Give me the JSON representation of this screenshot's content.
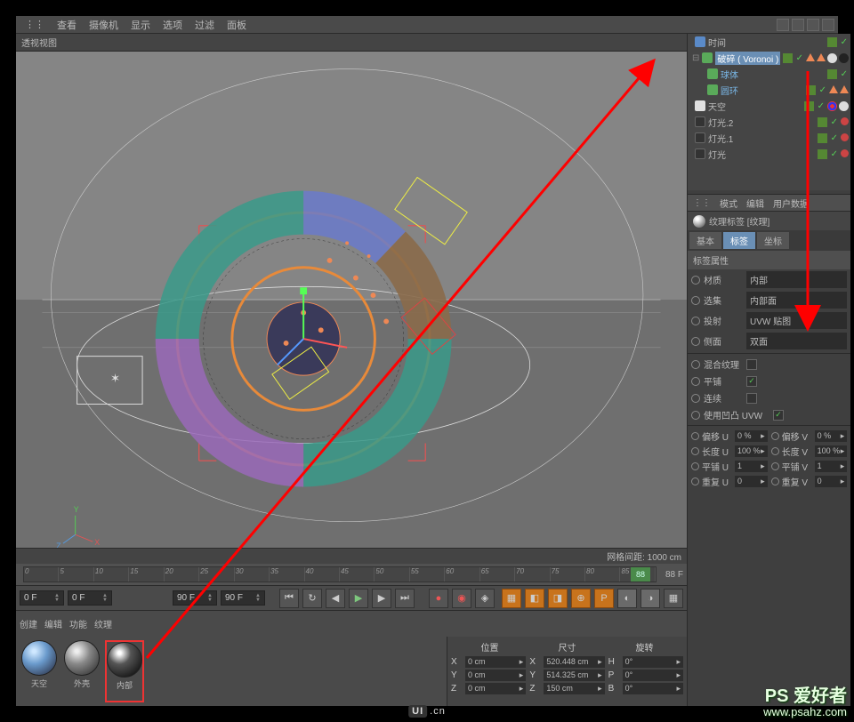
{
  "menu": {
    "view": "查看",
    "camera": "摄像机",
    "display": "显示",
    "options": "选项",
    "filter": "过滤",
    "panel": "面板"
  },
  "viewport": {
    "label": "透视视图",
    "footer": "网格间距: 1000 cm"
  },
  "timeline": {
    "ticks": [
      "0",
      "5",
      "10",
      "15",
      "20",
      "25",
      "30",
      "35",
      "40",
      "45",
      "50",
      "55",
      "60",
      "65",
      "70",
      "75",
      "80",
      "85"
    ],
    "playhead": "88",
    "frame_label": "88 F"
  },
  "transport": {
    "start": "0 F",
    "prev": "0 F",
    "end": "90 F",
    "next": "90 F"
  },
  "mat_menu": {
    "create": "创建",
    "edit": "编辑",
    "func": "功能",
    "tex": "纹理"
  },
  "materials": [
    {
      "id": "sky",
      "label": "天空"
    },
    {
      "id": "outer",
      "label": "外壳"
    },
    {
      "id": "inner",
      "label": "内部"
    }
  ],
  "coords": {
    "headers": [
      "位置",
      "尺寸",
      "旋转"
    ],
    "rows": [
      {
        "axis": "X",
        "pos": "0 cm",
        "size": "520.448 cm",
        "rot_lbl": "H",
        "rot": "0°"
      },
      {
        "axis": "Y",
        "pos": "0 cm",
        "size": "514.325 cm",
        "rot_lbl": "P",
        "rot": "0°"
      },
      {
        "axis": "Z",
        "pos": "0 cm",
        "size": "150 cm",
        "rot_lbl": "B",
        "rot": "0°"
      }
    ]
  },
  "objects": [
    {
      "name": "时间",
      "indent": 0,
      "icon": "blue",
      "tags": [
        "layer",
        "chk"
      ]
    },
    {
      "name": "破碎 ( Voronoi )",
      "indent": 0,
      "icon": "green",
      "sel": true,
      "expand": "⊟",
      "tags": [
        "layer",
        "chk",
        "tri",
        "tri",
        "sph",
        "sph-dk"
      ]
    },
    {
      "name": "球体",
      "indent": 1,
      "icon": "green",
      "blue": true,
      "tags": [
        "layer",
        "chk"
      ]
    },
    {
      "name": "圆环",
      "indent": 1,
      "icon": "green",
      "blue": true,
      "tags": [
        "layer",
        "chk",
        "tri",
        "tri"
      ]
    },
    {
      "name": "天空",
      "indent": 0,
      "icon": "white",
      "tags": [
        "layer",
        "chk",
        "tgt",
        "sph"
      ]
    },
    {
      "name": "灯光.2",
      "indent": 0,
      "icon": "black",
      "tags": [
        "layer",
        "chk",
        "small"
      ]
    },
    {
      "name": "灯光.1",
      "indent": 0,
      "icon": "black",
      "tags": [
        "layer",
        "chk",
        "small"
      ]
    },
    {
      "name": "灯光",
      "indent": 0,
      "icon": "black",
      "tags": [
        "layer",
        "chk",
        "small"
      ]
    }
  ],
  "attr_header": {
    "mode": "模式",
    "edit": "编辑",
    "user": "用户数据"
  },
  "attr_title": "纹理标签 [纹理]",
  "attr_tabs": {
    "basic": "基本",
    "tag": "标签",
    "coord": "坐标"
  },
  "section": "标签属性",
  "props": {
    "material": {
      "label": "材质",
      "value": "内部"
    },
    "selection": {
      "label": "选集",
      "value": "内部面"
    },
    "projection": {
      "label": "投射",
      "value": "UVW 贴图"
    },
    "side": {
      "label": "侧面",
      "value": "双面"
    },
    "blend": {
      "label": "混合纹理"
    },
    "tile": {
      "label": "平铺",
      "checked": true
    },
    "continuous": {
      "label": "连续"
    },
    "use_uvw": {
      "label": "使用凹凸 UVW",
      "checked": true
    }
  },
  "uv": {
    "rows": [
      {
        "l1": "偏移 U",
        "v1": "0 %",
        "l2": "偏移 V",
        "v2": "0 %"
      },
      {
        "l1": "长度 U",
        "v1": "100 %",
        "l2": "长度 V",
        "v2": "100 %"
      },
      {
        "l1": "平铺 U",
        "v1": "1",
        "l2": "平铺 V",
        "v2": "1"
      },
      {
        "l1": "重复 U",
        "v1": "0",
        "l2": "重复 V",
        "v2": "0"
      }
    ]
  },
  "watermark": {
    "title": "PS 爱好者",
    "url": "www.psahz.com",
    "center": "UI.cn"
  }
}
